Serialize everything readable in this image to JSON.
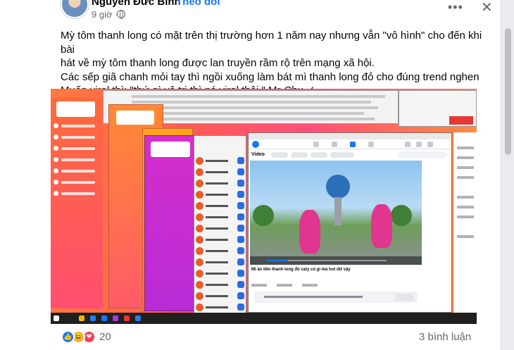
{
  "post": {
    "author": "Nguyễn Đức Bình",
    "separator": "·",
    "follow_label": "Theo dõi",
    "time": "9 giờ ·",
    "more_icon": "ellipsis-icon",
    "close_icon": "close-icon",
    "text_lines": [
      "Mỳ tôm thanh long có mặt trên thị trường hơn 1 năm nay nhưng vẫn \"vô hình\" cho đến khi bài",
      "hát về mỳ tôm thanh long được lan truyền rầm rộ trên mạng xã hội.",
      "Các sếp giã chanh mỏi tay thì ngồi xuống làm bát mì thanh long đỏ cho đúng trend nghen",
      "Muốn viral thì: \"thứ gì vô tri thì nó viral thôi \" Mr-Chu ✓"
    ]
  },
  "media": {
    "video_caption": "Mì ăn liền thanh long đỏ caty có gì mà hot dữ vậy",
    "section_title": "Video"
  },
  "footer": {
    "reaction_icons": [
      "like-icon",
      "haha-icon",
      "love-icon"
    ],
    "like_glyph": "👍",
    "haha_glyph": "😆",
    "love_glyph": "❤",
    "reaction_count": "20",
    "comment_count": "3 bình luận"
  },
  "colors": {
    "link": "#1877f2",
    "secondary_text": "#65676b",
    "like": "#1877f2",
    "haha": "#f7b125",
    "love": "#f33e58"
  }
}
